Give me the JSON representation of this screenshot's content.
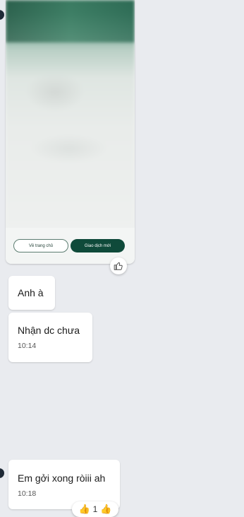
{
  "image_card": {
    "home_button": "Về trang chủ",
    "new_transaction_button": "Giao dịch mới"
  },
  "messages": [
    {
      "text": "Anh à",
      "time": ""
    },
    {
      "text": "Nhận dc chưa",
      "time": "10:14"
    },
    {
      "text": "Em gởi xong ròiii ah",
      "time": "10:18"
    }
  ],
  "reactions": {
    "count": "1"
  },
  "colors": {
    "background": "#e9ebef",
    "bubble": "#ffffff",
    "primary_green": "#0f4a3a"
  }
}
